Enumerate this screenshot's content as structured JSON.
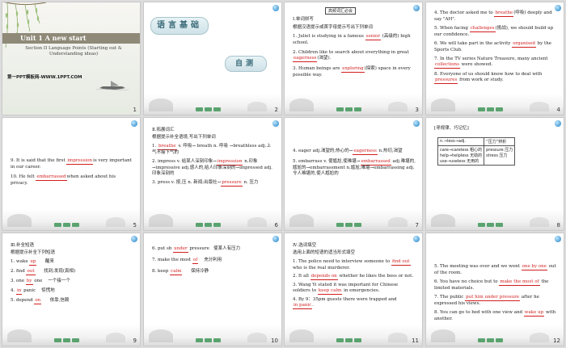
{
  "slides": [
    {
      "n": "1",
      "title": "Unit 1    A new start",
      "subtitle": "Section II  Language Points (Starting out & Understanding ideas)",
      "footer": "第一PPT模板网-WWW.1PPT.COM"
    },
    {
      "n": "2",
      "pill1": "语言基础",
      "pill2": "自测"
    },
    {
      "n": "3",
      "header": "高频词汇必会",
      "instr": "根据汉语提示或首字母提示写出下列单词",
      "l1a": "1.  Juliet is studying in a famous",
      "l1b": "senior",
      "l1c": "(高级的) high school.",
      "l2a": "2.  Children like to search about everything in great",
      "l2b": "eagerness",
      "l2c": "(渴望).",
      "l3a": "3.  Human beings are",
      "l3b": "exploring",
      "l3c": "(探索) space in every possible way."
    },
    {
      "n": "4",
      "l4a": "4.  The doctor asked me to",
      "l4b": "breathe",
      "l4c": "(呼吸) deeply and say \"AH\".",
      "l5a": "5.  When facing",
      "l5b": "challenges",
      "l5c": "(挑战), we should build up our confidence.",
      "l6a": "6.  We will take part in the activity",
      "l6b": "organised",
      "l6c": "by the Sports Club.",
      "l7a": "7.  In the TV series Nature Treasure, many ancient",
      "l7b": "collections",
      "l7c": "were showed.",
      "l8a": "8.  Everyone of us should know how to deal with",
      "l8b": "pressures",
      "l8c": "from work or study."
    },
    {
      "n": "5",
      "l9a": "9.  It is said that the first",
      "l9b": "impression",
      "l9c": "is very important in our career.",
      "l10a": "10.  He felt",
      "l10b": "embarrassed",
      "l10c": "when asked about his privacy."
    },
    {
      "n": "6",
      "head": "Ⅱ.拓展词汇",
      "instr": "根据提示补全语境,写出下列单词",
      "i1a": "1.",
      "i1b": "breathe",
      "i1c": "v. 呼吸→ breath n. 呼吸 →breathless adj.上气不接下气的",
      "i2a": "2. impress v. 给某人深刻印象→",
      "i2b": "impression",
      "i2c": "n.印象→impressive adj.感人的,给人印象深刻的→impressed adj.印象深刻的",
      "i3a": "3. press v. 按,压 n. 新闻;出版社→",
      "i3b": "pressure",
      "i3c": "n. 压力"
    },
    {
      "n": "7",
      "e4a": "4. eager adj.渴望的;热心的→",
      "e4b": "eagerness",
      "e4c": "n.热切,渴望",
      "e5a": "5. embarrass v. 使尴尬,使难堪→",
      "e5b": "embarrassed",
      "e5c": "adj.难堪的,尴尬的→embarrassment n.尴尬;难堪→embarrassing adj.令人难堪的,使人尴尬的"
    },
    {
      "n": "8",
      "head": "[寻规律、巧记忆]",
      "c1": "n.→less→adj.",
      "c2": "“压力”辨析",
      "c3": "care→careless 粗心的",
      "c4": "help→helpless 无助的",
      "c5": "use→useless 无用的",
      "c6": "pressure 压力",
      "c7": "stress 压力"
    },
    {
      "n": "9",
      "head": "Ⅲ.补全短语",
      "instr": "根据提示补全下列短语",
      "p1a": "1. wake",
      "p1b": "up",
      "p1c": "醒来",
      "p2a": "2. find",
      "p2b": "out",
      "p2c": "找到;发现(真相)",
      "p3a": "3. one",
      "p3b": "by",
      "p3c": "one",
      "p3d": "一个接一个",
      "p4a": "4.",
      "p4b": "in",
      "p4c": "panic",
      "p4d": "惊慌地",
      "p5a": "5. depend",
      "p5b": "on",
      "p5c": "依靠,信赖"
    },
    {
      "n": "10",
      "q6a": "6. put sb",
      "q6b": "under",
      "q6c": "pressure",
      "q6d": "使某人有压力",
      "q7a": "7. make the most",
      "q7b": "of",
      "q7c": "充分利用",
      "q8a": "8. keep",
      "q8b": "calm",
      "q8c": "保持冷静"
    },
    {
      "n": "11",
      "head": "Ⅳ.选词填空",
      "instr": "选用上面的短语的适当形式填空",
      "r1a": "1.  The police need to interview someone to",
      "r1b": "find out",
      "r1c": "who is the real murderer.",
      "r2a": "2.  It all",
      "r2b": "depends on",
      "r2c": "whether he likes the boss or not.",
      "r3a": "3.  Wang Yi stated it was important for Chinese soldiers to",
      "r3b": "keep calm",
      "r3c": "in emergencies.",
      "r4a": "4.  By 9：35pm guests there were trapped and",
      "r4b": "in panic",
      "r4c": "."
    },
    {
      "n": "12",
      "r5a": "5.  The meeting was over and we went",
      "r5b": "one by one",
      "r5c": "out of the room.",
      "r6a": "6.  You have no choice but to",
      "r6b": "make the most of",
      "r6c": "the limited materials.",
      "r7a": "7.  The public",
      "r7b": "put him under pressure",
      "r7c": "after he expressed his views.",
      "r8a": "8.  You can go to bed with one view and",
      "r8b": "wake up",
      "r8c": "with another."
    }
  ]
}
